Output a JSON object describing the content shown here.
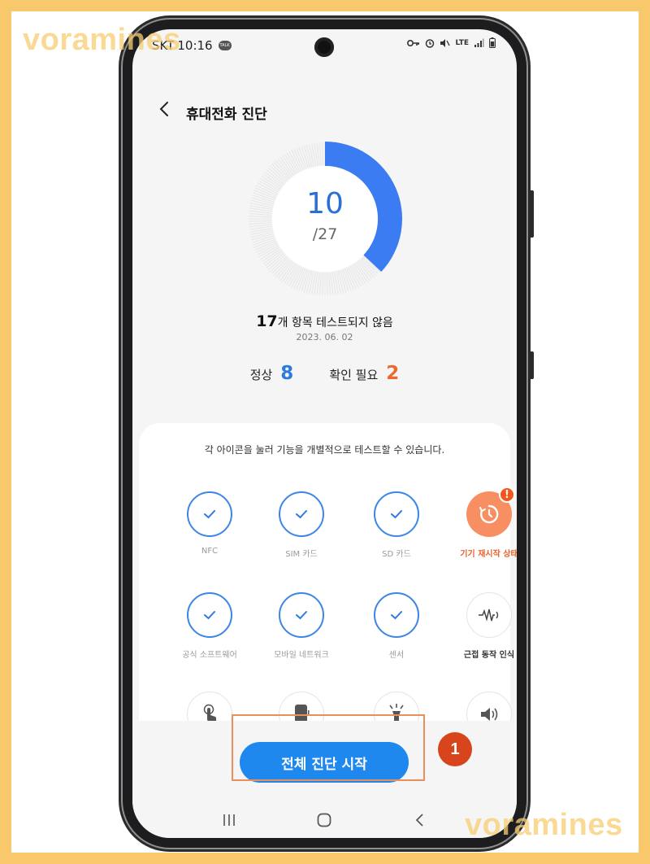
{
  "watermark": "voramines",
  "status_bar": {
    "carrier": "SKT",
    "time": "10:16",
    "talk_badge": "TALK",
    "network": "LTE",
    "icons": [
      "key-icon",
      "alarm-icon",
      "mute-icon",
      "lte-icon",
      "signal-icon",
      "battery-icon"
    ]
  },
  "header": {
    "title": "휴대전화 진단",
    "back_icon": "chevron-left-icon"
  },
  "progress": {
    "done": "10",
    "total": "/27",
    "fraction": 0.37,
    "accent": "#3b7cf2"
  },
  "summary": {
    "count": "17",
    "text": "개 항목 테스트되지 않음",
    "date": "2023. 06. 02"
  },
  "stats": {
    "ok_label": "정상",
    "ok_value": "8",
    "warn_label": "확인 필요",
    "warn_value": "2"
  },
  "card": {
    "caption": "각 아이콘을 눌러 기능을 개별적으로 테스트할 수 있습니다.",
    "tiles": [
      {
        "label": "NFC",
        "state": "ok"
      },
      {
        "label": "SIM 카드",
        "state": "ok"
      },
      {
        "label": "SD 카드",
        "state": "ok"
      },
      {
        "label": "기기 재시작 상태",
        "state": "warning",
        "icon": "restart-timer-icon",
        "badge": "!"
      },
      {
        "label": "공식 소프트웨어",
        "state": "ok"
      },
      {
        "label": "모바일 네트워크",
        "state": "ok"
      },
      {
        "label": "센서",
        "state": "ok"
      },
      {
        "label": "근접 동작 인식",
        "state": "untested",
        "icon": "proximity-wave-icon"
      },
      {
        "label": "",
        "state": "untested",
        "icon": "touch-hand-icon"
      },
      {
        "label": "",
        "state": "untested",
        "icon": "phone-screen-icon"
      },
      {
        "label": "",
        "state": "untested",
        "icon": "flashlight-icon"
      },
      {
        "label": "",
        "state": "untested",
        "icon": "speaker-icon"
      }
    ]
  },
  "start_button": {
    "label": "전체 진단 시작"
  },
  "annotation": {
    "step": "1"
  },
  "navbar": {
    "items": [
      "recents-icon",
      "home-icon",
      "back-icon"
    ]
  }
}
